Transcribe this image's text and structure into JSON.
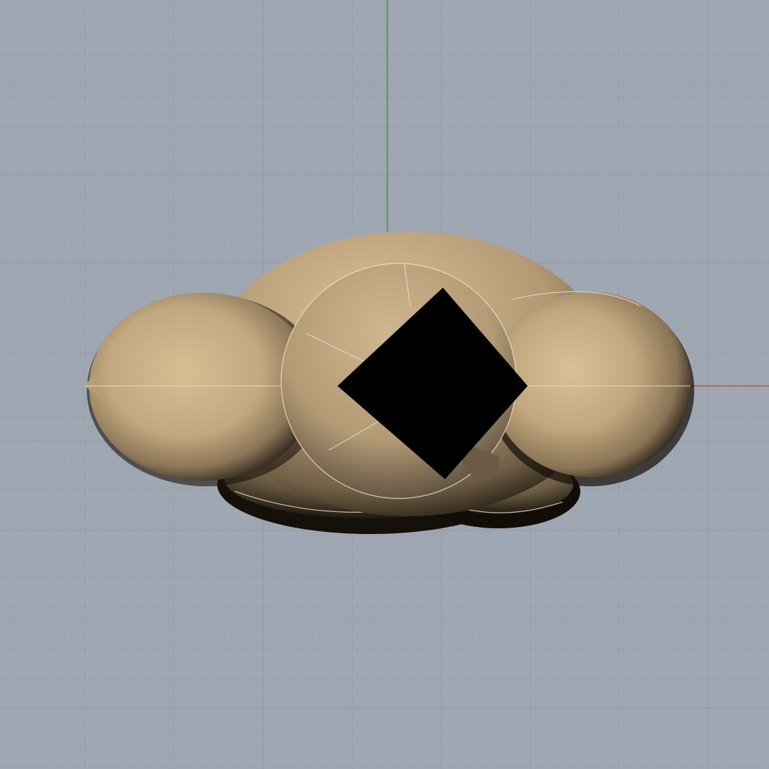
{
  "viewport": {
    "view": "Top",
    "display_mode": "Shaded",
    "colors": {
      "background": "#9ea6b1",
      "minor_grid": "#a9b0ba",
      "major_grid": "#8f98a3",
      "x_axis": "#c0504d",
      "y_axis": "#3a9a3a",
      "object_base": "#c9b08b",
      "object_shadow": "#1a140c",
      "edge_highlight": "#efe2c6",
      "cutout": "#000000"
    },
    "axes": [
      "x-axis",
      "y-axis"
    ],
    "objects": [
      {
        "name": "main-body",
        "shape": "ellipsoid"
      },
      {
        "name": "left-lobe",
        "shape": "ellipsoid"
      },
      {
        "name": "right-lobe",
        "shape": "ellipsoid"
      },
      {
        "name": "center-disc",
        "shape": "sphere"
      },
      {
        "name": "bottom-lobe",
        "shape": "ellipsoid"
      },
      {
        "name": "diamond-cutout",
        "shape": "box",
        "fill": "black"
      }
    ]
  }
}
